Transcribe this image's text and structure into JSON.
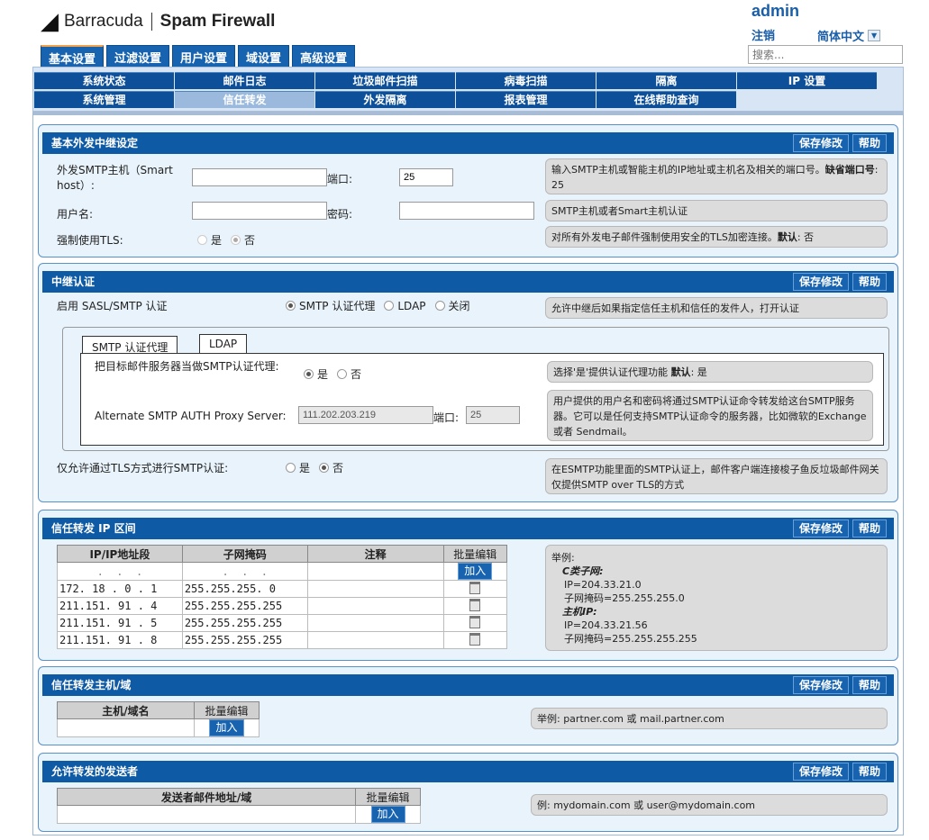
{
  "header": {
    "brand": "Barracuda",
    "product": "Spam Firewall",
    "user": "admin",
    "logout": "注销",
    "language": "简体中文",
    "search_placeholder": "搜索..."
  },
  "main_tabs": [
    "基本设置",
    "过滤设置",
    "用户设置",
    "域设置",
    "高级设置"
  ],
  "sub_nav": [
    "系统状态",
    "邮件日志",
    "垃圾邮件扫描",
    "病毒扫描",
    "隔离",
    "IP 设置",
    "系统管理",
    "信任转发",
    "外发隔离",
    "报表管理",
    "在线帮助查询"
  ],
  "common": {
    "save": "保存修改",
    "help": "帮助",
    "yes": "是",
    "no": "否",
    "add": "加入",
    "bulk_edit": "批量编辑"
  },
  "relay": {
    "title": "基本外发中继设定",
    "smtp_host_label": "外发SMTP主机（Smart host）:",
    "smtp_host_value": "",
    "port_label": "端口:",
    "port_value": "25",
    "help1_a": "输入SMTP主机或智能主机的IP地址或主机名及相关的端口号。",
    "help1_b": "缺省端口号",
    "help1_c": ": 25",
    "username_label": "用户名:",
    "password_label": "密码:",
    "help2": "SMTP主机或者Smart主机认证",
    "tls_label": "强制使用TLS:",
    "help3_a": "对所有外发电子邮件强制使用安全的TLS加密连接。",
    "help3_b": "默认",
    "help3_c": ": 否"
  },
  "auth": {
    "title": "中继认证",
    "sasl_label": "启用 SASL/SMTP 认证",
    "opt_proxy": "SMTP 认证代理",
    "opt_ldap": "LDAP",
    "opt_off": "关闭",
    "help_sasl": "允许中继后如果指定信任主机和信任的发件人，打开认证",
    "tab_proxy": "SMTP 认证代理",
    "tab_ldap": "LDAP",
    "dest_label": "把目标邮件服务器当做SMTP认证代理:",
    "help_dest_a": "选择'是'提供认证代理功能",
    "help_dest_b": "默认",
    "help_dest_c": ": 是",
    "alt_label": "Alternate SMTP AUTH Proxy Server:",
    "alt_value": "111.202.203.219",
    "alt_port_label": "端口:",
    "alt_port_value": "25",
    "help_alt": "用户提供的用户名和密码将通过SMTP认证命令转发给这台SMTP服务器。它可以是任何支持SMTP认证命令的服务器，比如微软的Exchange 或者 Sendmail。",
    "tls_only_label": "仅允许通过TLS方式进行SMTP认证:",
    "help_tls_only": "在ESMTP功能里面的SMTP认证上，邮件客户端连接梭子鱼反垃圾邮件网关仅提供SMTP over TLS的方式"
  },
  "trusted_ip": {
    "title": "信任转发 IP 区间",
    "columns": [
      "IP/IP地址段",
      "子网掩码",
      "注释"
    ],
    "rows": [
      {
        "ip": "172. 18 . 0 . 1",
        "mask": "255.255.255. 0",
        "note": ""
      },
      {
        "ip": "211.151. 91 . 4",
        "mask": "255.255.255.255",
        "note": ""
      },
      {
        "ip": "211.151. 91 . 5",
        "mask": "255.255.255.255",
        "note": ""
      },
      {
        "ip": "211.151. 91 . 8",
        "mask": "255.255.255.255",
        "note": ""
      }
    ],
    "example_title": "举例:",
    "c_class": "C类子网:",
    "c_ip": "IP=204.33.21.0",
    "c_mask": "子网掩码=255.255.255.0",
    "host": "主机IP:",
    "h_ip": "IP=204.33.21.56",
    "h_mask": "子网掩码=255.255.255.255"
  },
  "trusted_host": {
    "title": "信任转发主机/域",
    "column": "主机/域名",
    "help": "举例: partner.com 或 mail.partner.com"
  },
  "senders": {
    "title": "允许转发的发送者",
    "column": "发送者邮件地址/域",
    "help": "例: mydomain.com 或 user@mydomain.com"
  }
}
